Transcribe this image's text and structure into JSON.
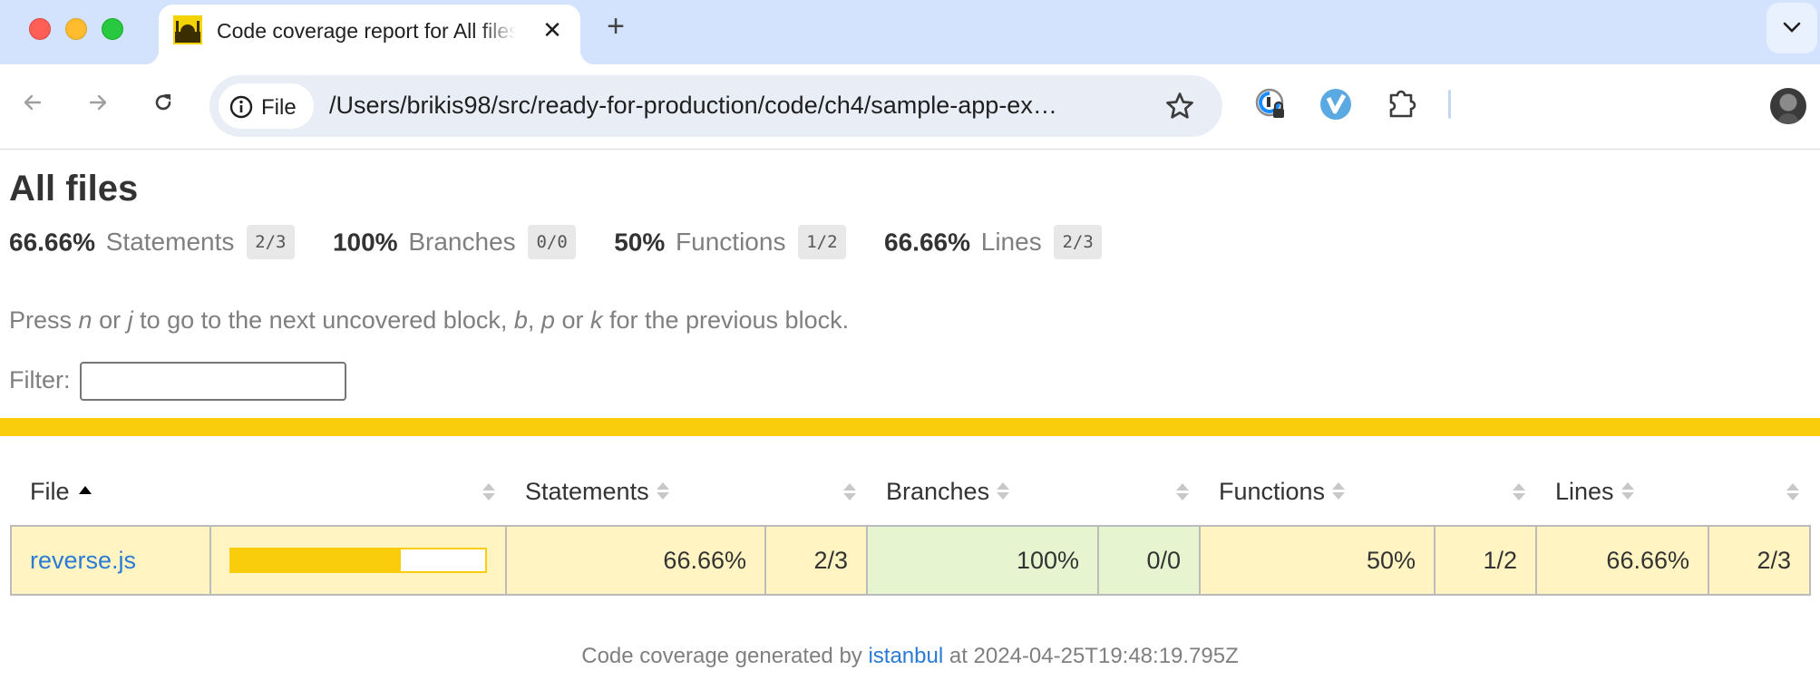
{
  "browser": {
    "tab_title": "Code coverage report for All files",
    "tab_close_glyph": "✕",
    "new_tab_glyph": "+",
    "chip_label": "File",
    "url": "/Users/brikis98/src/ready-for-production/code/ch4/sample-app-ex…"
  },
  "page": {
    "title": "All files",
    "summary": [
      {
        "pct": "66.66%",
        "label": "Statements",
        "fraction": "2/3"
      },
      {
        "pct": "100%",
        "label": "Branches",
        "fraction": "0/0"
      },
      {
        "pct": "50%",
        "label": "Functions",
        "fraction": "1/2"
      },
      {
        "pct": "66.66%",
        "label": "Lines",
        "fraction": "2/3"
      }
    ],
    "hint": {
      "t1": "Press ",
      "k1": "n",
      "t2": " or ",
      "k2": "j",
      "t3": " to go to the next uncovered block, ",
      "k3": "b",
      "t4": ", ",
      "k4": "p",
      "t5": " or ",
      "k5": "k",
      "t6": " for the previous block."
    },
    "filter_label": "Filter:",
    "filter_value": "",
    "status_color": "#f9cd0b"
  },
  "table": {
    "headers": {
      "file": "File",
      "statements": "Statements",
      "branches": "Branches",
      "functions": "Functions",
      "lines": "Lines"
    },
    "rows": [
      {
        "file": "reverse.js",
        "coverage_fraction": 0.6666,
        "statements_pct": "66.66%",
        "statements_frac": "2/3",
        "branches_pct": "100%",
        "branches_frac": "0/0",
        "functions_pct": "50%",
        "functions_frac": "1/2",
        "lines_pct": "66.66%",
        "lines_frac": "2/3"
      }
    ]
  },
  "footer": {
    "prefix": "Code coverage generated by ",
    "link": "istanbul",
    "suffix": " at 2024-04-25T19:48:19.795Z"
  },
  "colors": {
    "medium_bg": "#fff4c2",
    "high_bg": "#e6f5d0",
    "accent_yellow": "#f9cd0b",
    "link_blue": "#2b7bd6"
  }
}
